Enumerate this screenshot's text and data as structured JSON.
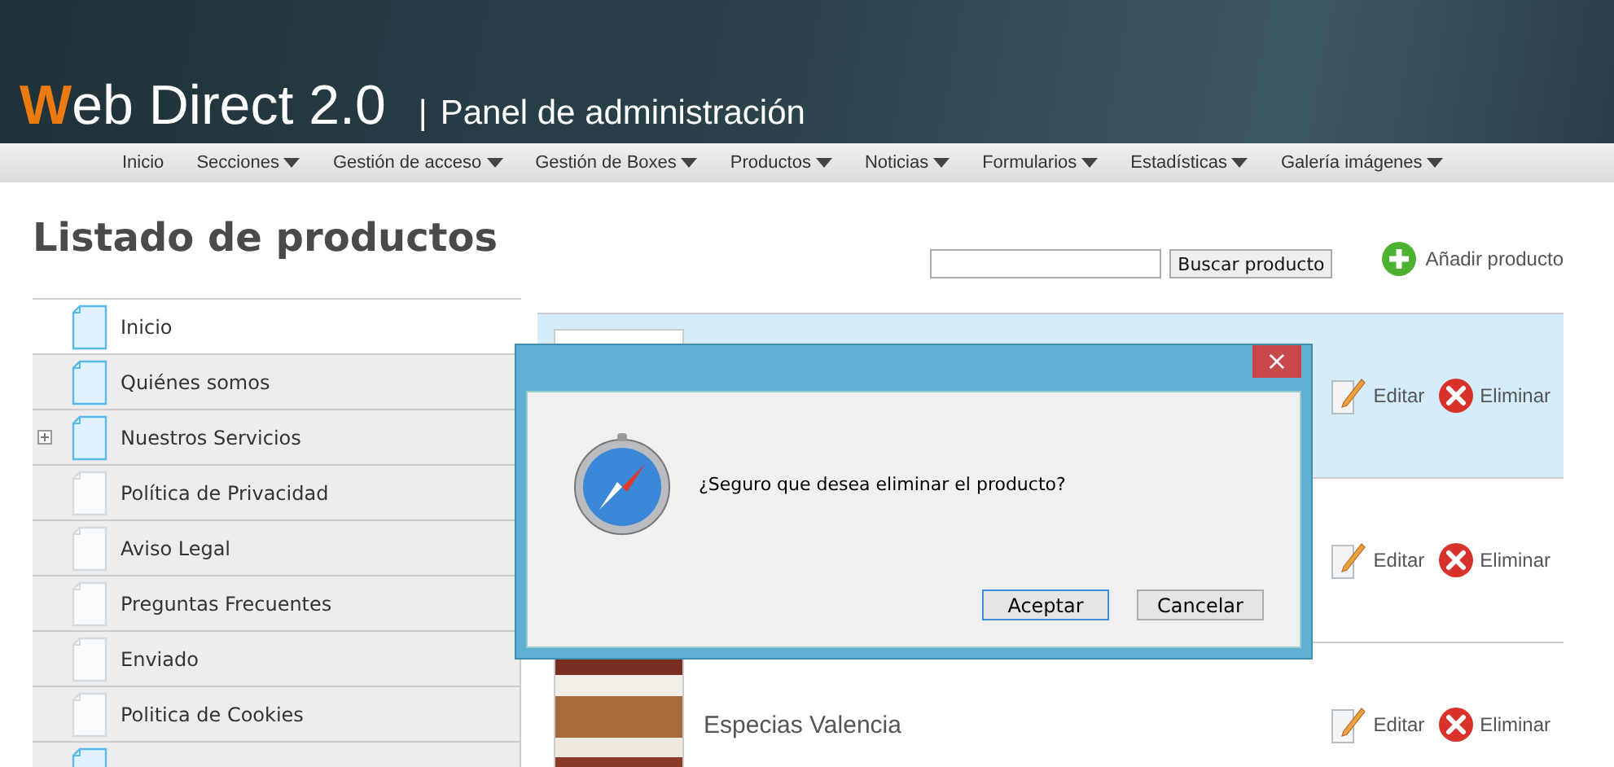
{
  "header": {
    "logo": "Web Direct 2.0",
    "divider": "|",
    "subtitle": "Panel de administración"
  },
  "nav": [
    {
      "label": "Inicio",
      "dropdown": false
    },
    {
      "label": "Secciones",
      "dropdown": true
    },
    {
      "label": "Gestión de acceso",
      "dropdown": true
    },
    {
      "label": "Gestión de Boxes",
      "dropdown": true
    },
    {
      "label": "Productos",
      "dropdown": true
    },
    {
      "label": "Noticias",
      "dropdown": true
    },
    {
      "label": "Formularios",
      "dropdown": true
    },
    {
      "label": "Estadísticas",
      "dropdown": true
    },
    {
      "label": "Galería imágenes",
      "dropdown": true
    }
  ],
  "page_title": "Listado de productos",
  "search": {
    "button": "Buscar producto"
  },
  "add_product": "Añadir producto",
  "sidebar": {
    "items": [
      {
        "label": "Inicio",
        "kind": "linked",
        "expandable": false,
        "selected": true
      },
      {
        "label": "Quiénes somos",
        "kind": "linked",
        "expandable": false,
        "selected": false
      },
      {
        "label": "Nuestros Servicios",
        "kind": "linked",
        "expandable": true,
        "selected": false
      },
      {
        "label": "Política de Privacidad",
        "kind": "plain",
        "expandable": false,
        "selected": false
      },
      {
        "label": "Aviso Legal",
        "kind": "plain",
        "expandable": false,
        "selected": false
      },
      {
        "label": "Preguntas Frecuentes",
        "kind": "plain",
        "expandable": false,
        "selected": false
      },
      {
        "label": "Enviado",
        "kind": "plain",
        "expandable": false,
        "selected": false
      },
      {
        "label": "Politica de Cookies",
        "kind": "plain",
        "expandable": false,
        "selected": false
      },
      {
        "kind": "linked",
        "expandable": false,
        "selected": false
      }
    ]
  },
  "products": [
    {
      "selected": true,
      "edit": "Editar",
      "delete": "Eliminar"
    },
    {
      "selected": false,
      "edit": "Editar",
      "delete": "Eliminar"
    },
    {
      "name": "Especias Valencia",
      "selected": false,
      "edit": "Editar",
      "delete": "Eliminar"
    }
  ],
  "dialog": {
    "message": "¿Seguro que desea eliminar el producto?",
    "close": "×",
    "buttons": [
      {
        "label": "Aceptar",
        "selected": true
      },
      {
        "label": "Cancelar",
        "selected": false
      }
    ]
  }
}
